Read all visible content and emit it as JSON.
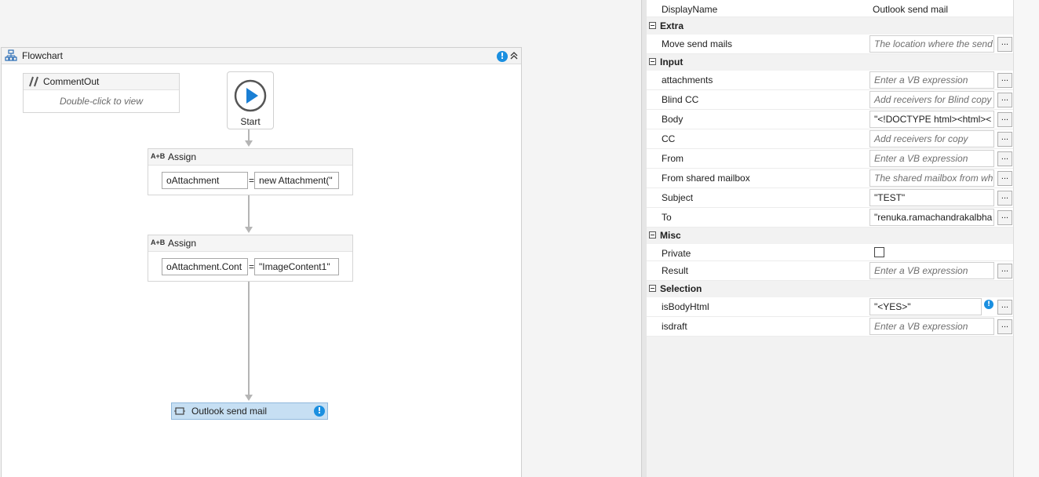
{
  "designer": {
    "flowchart": {
      "title": "Flowchart"
    },
    "comment_out": {
      "title": "CommentOut",
      "hint": "Double-click to view"
    },
    "start": {
      "label": "Start"
    },
    "assign1": {
      "title": "Assign",
      "to": "oAttachment",
      "eq": "=",
      "value": "new Attachment(\""
    },
    "assign2": {
      "title": "Assign",
      "to": "oAttachment.Cont",
      "eq": "=",
      "value": "\"ImageContent1\""
    },
    "outlook": {
      "title": "Outlook send mail"
    }
  },
  "properties": {
    "top_row": {
      "label": "DisplayName",
      "value": "Outlook send mail"
    },
    "categories": {
      "extra": "Extra",
      "input": "Input",
      "misc": "Misc",
      "selection": "Selection"
    },
    "extra": [
      {
        "label": "Move send mails",
        "value": "The location where the send",
        "placeholder": true
      }
    ],
    "input": [
      {
        "label": "attachments",
        "value": "Enter a VB expression",
        "placeholder": true
      },
      {
        "label": "Blind CC",
        "value": "Add receivers for Blind copy",
        "placeholder": true
      },
      {
        "label": "Body",
        "value": "\"<!DOCTYPE html><html><",
        "placeholder": false
      },
      {
        "label": "CC",
        "value": "Add receivers for copy",
        "placeholder": true
      },
      {
        "label": "From",
        "value": "Enter a VB expression",
        "placeholder": true
      },
      {
        "label": "From shared mailbox",
        "value": "The shared mailbox from wh",
        "placeholder": true
      },
      {
        "label": "Subject",
        "value": "\"TEST\"",
        "placeholder": false
      },
      {
        "label": "To",
        "value": "\"renuka.ramachandrakalbha",
        "placeholder": false
      }
    ],
    "misc": [
      {
        "label": "Private",
        "checked": false
      },
      {
        "label": "Result",
        "value": "Enter a VB expression",
        "placeholder": true
      }
    ],
    "selection": [
      {
        "label": "isBodyHtml",
        "value": "\"<YES>\"",
        "placeholder": false
      },
      {
        "label": "isdraft",
        "value": "Enter a VB expression",
        "placeholder": true
      }
    ],
    "ellipsis": "..."
  },
  "colors": {
    "accent": "#1a8fe0",
    "selected_activity": "#c6dff3"
  }
}
